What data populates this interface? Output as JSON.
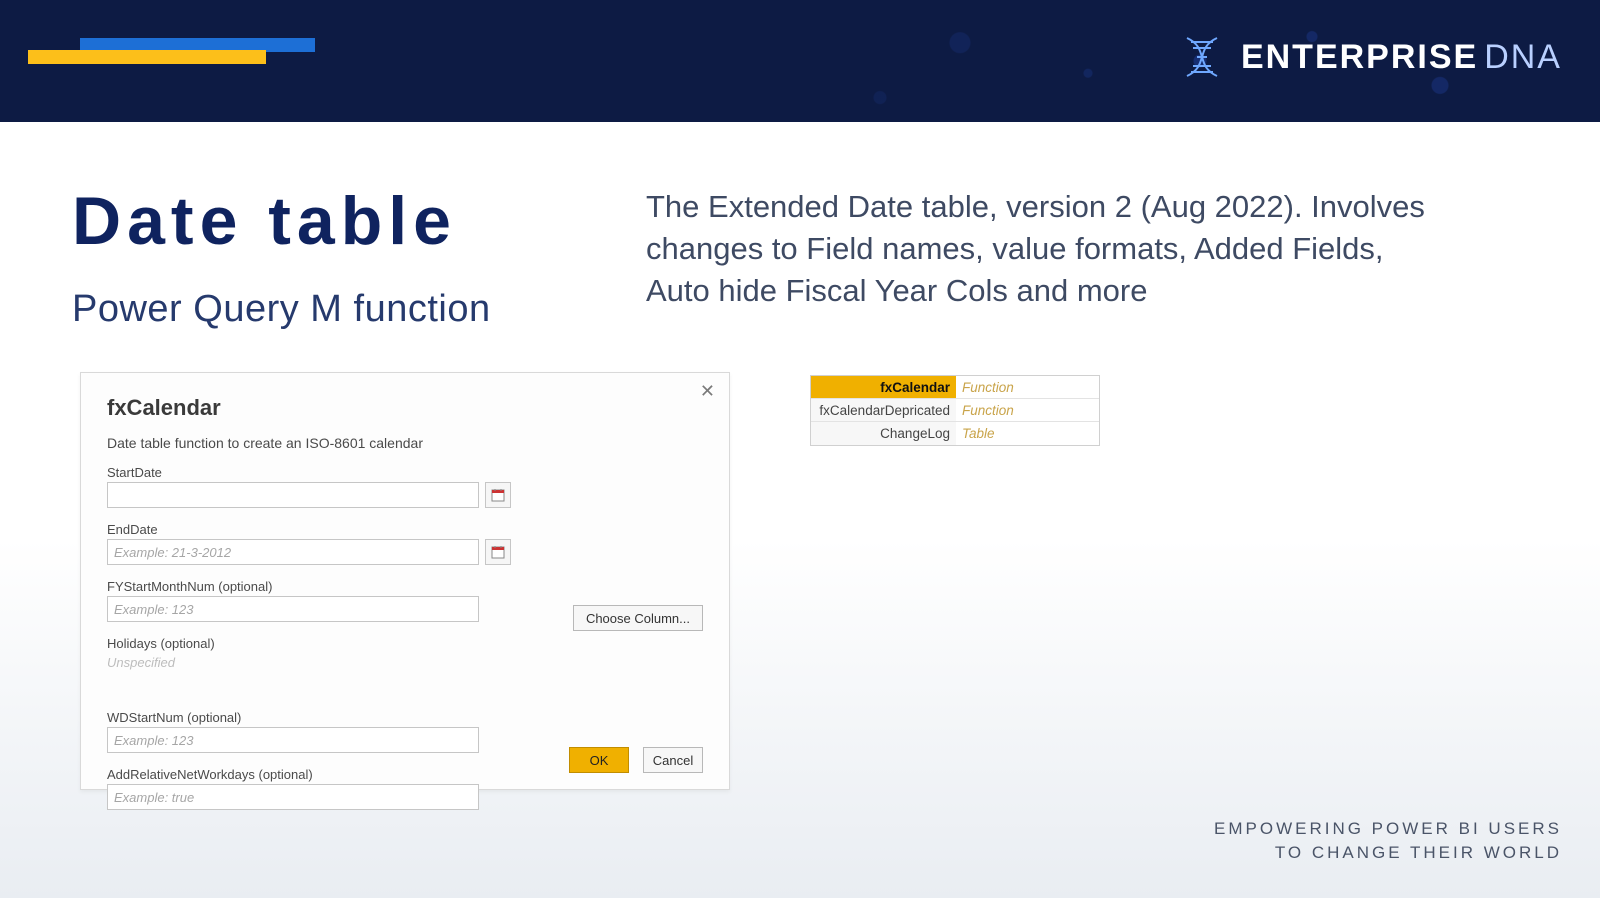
{
  "brand": {
    "name": "ENTERPRISE",
    "suffix": "DNA"
  },
  "headings": {
    "title": "Date table",
    "subtitle": "Power Query M function",
    "description": "The Extended Date table, version 2 (Aug 2022). Involves changes to Field names, value formats, Added Fields, Auto hide Fiscal Year Cols and more"
  },
  "dialog": {
    "title": "fxCalendar",
    "description": "Date table function to create an ISO-8601 calendar",
    "fields": {
      "startDate": {
        "label": "StartDate",
        "placeholder": ""
      },
      "endDate": {
        "label": "EndDate",
        "placeholder": "Example: 21-3-2012"
      },
      "fyStart": {
        "label": "FYStartMonthNum (optional)",
        "placeholder": "Example: 123"
      },
      "holidays": {
        "label": "Holidays (optional)",
        "unspecified": "Unspecified",
        "chooseColumn": "Choose Column..."
      },
      "wdStart": {
        "label": "WDStartNum (optional)",
        "placeholder": "Example: 123"
      },
      "addRelNet": {
        "label": "AddRelativeNetWorkdays (optional)",
        "placeholder": "Example: true"
      }
    },
    "buttons": {
      "ok": "OK",
      "cancel": "Cancel"
    }
  },
  "miniTable": {
    "rows": [
      {
        "name": "fxCalendar",
        "type": "Function",
        "selected": true
      },
      {
        "name": "fxCalendarDepricated",
        "type": "Function",
        "selected": false
      },
      {
        "name": "ChangeLog",
        "type": "Table",
        "selected": false
      }
    ]
  },
  "footer": {
    "line1": "EMPOWERING POWER BI USERS",
    "line2": "TO CHANGE THEIR WORLD"
  }
}
